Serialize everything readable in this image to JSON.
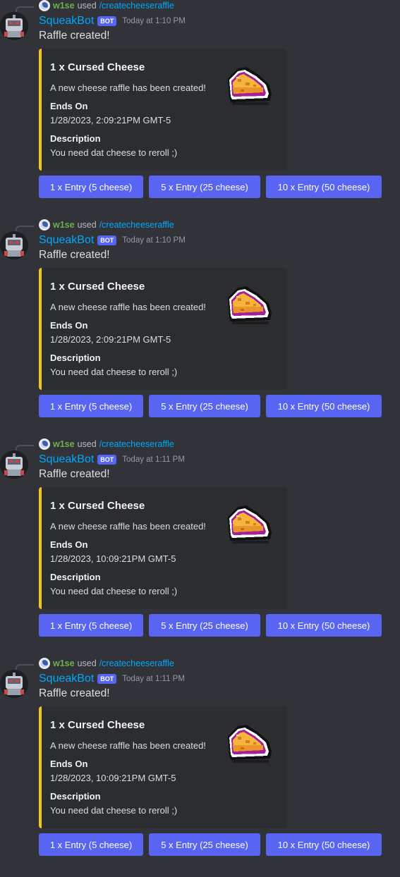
{
  "messages": [
    {
      "reply": {
        "user": "w1se",
        "used": "used",
        "command": "/createcheeseraffle"
      },
      "username": "SqueakBot",
      "bot_tag": "BOT",
      "timestamp": "Today at 1:10 PM",
      "content": "Raffle created!",
      "embed": {
        "accent_color": "#f5c518",
        "title": "1 x Cursed Cheese",
        "description": "A new cheese raffle has been created!",
        "fields": [
          {
            "name": "Ends On",
            "value": "1/28/2023, 2:09:21PM GMT-5"
          },
          {
            "name": "Description",
            "value": "You need dat cheese to reroll ;)"
          }
        ],
        "thumbnail": "cheese-icon"
      },
      "buttons": [
        "1 x Entry (5 cheese)",
        "5 x Entry (25 cheese)",
        "10 x Entry (50 cheese)"
      ]
    },
    {
      "reply": {
        "user": "w1se",
        "used": "used",
        "command": "/createcheeseraffle"
      },
      "username": "SqueakBot",
      "bot_tag": "BOT",
      "timestamp": "Today at 1:10 PM",
      "content": "Raffle created!",
      "embed": {
        "accent_color": "#f5c518",
        "title": "1 x Cursed Cheese",
        "description": "A new cheese raffle has been created!",
        "fields": [
          {
            "name": "Ends On",
            "value": "1/28/2023, 2:09:21PM GMT-5"
          },
          {
            "name": "Description",
            "value": "You need dat cheese to reroll ;)"
          }
        ],
        "thumbnail": "cheese-icon"
      },
      "buttons": [
        "1 x Entry (5 cheese)",
        "5 x Entry (25 cheese)",
        "10 x Entry (50 cheese)"
      ]
    },
    {
      "reply": {
        "user": "w1se",
        "used": "used",
        "command": "/createcheeseraffle"
      },
      "username": "SqueakBot",
      "bot_tag": "BOT",
      "timestamp": "Today at 1:11 PM",
      "content": "Raffle created!",
      "embed": {
        "accent_color": "#f5c518",
        "title": "1 x Cursed Cheese",
        "description": "A new cheese raffle has been created!",
        "fields": [
          {
            "name": "Ends On",
            "value": "1/28/2023, 10:09:21PM GMT-5"
          },
          {
            "name": "Description",
            "value": "You need dat cheese to reroll ;)"
          }
        ],
        "thumbnail": "cheese-icon"
      },
      "buttons": [
        "1 x Entry (5 cheese)",
        "5 x Entry (25 cheese)",
        "10 x Entry (50 cheese)"
      ]
    },
    {
      "reply": {
        "user": "w1se",
        "used": "used",
        "command": "/createcheeseraffle"
      },
      "username": "SqueakBot",
      "bot_tag": "BOT",
      "timestamp": "Today at 1:11 PM",
      "content": "Raffle created!",
      "embed": {
        "accent_color": "#f5c518",
        "title": "1 x Cursed Cheese",
        "description": "A new cheese raffle has been created!",
        "fields": [
          {
            "name": "Ends On",
            "value": "1/28/2023, 10:09:21PM GMT-5"
          },
          {
            "name": "Description",
            "value": "You need dat cheese to reroll ;)"
          }
        ],
        "thumbnail": "cheese-icon"
      },
      "buttons": [
        "1 x Entry (5 cheese)",
        "5 x Entry (25 cheese)",
        "10 x Entry (50 cheese)"
      ]
    }
  ],
  "colors": {
    "background": "#313338",
    "embed_background": "#2b2d31",
    "button": "#5865f2",
    "username": "#00a8fc",
    "reply_user": "#6bb24a"
  }
}
